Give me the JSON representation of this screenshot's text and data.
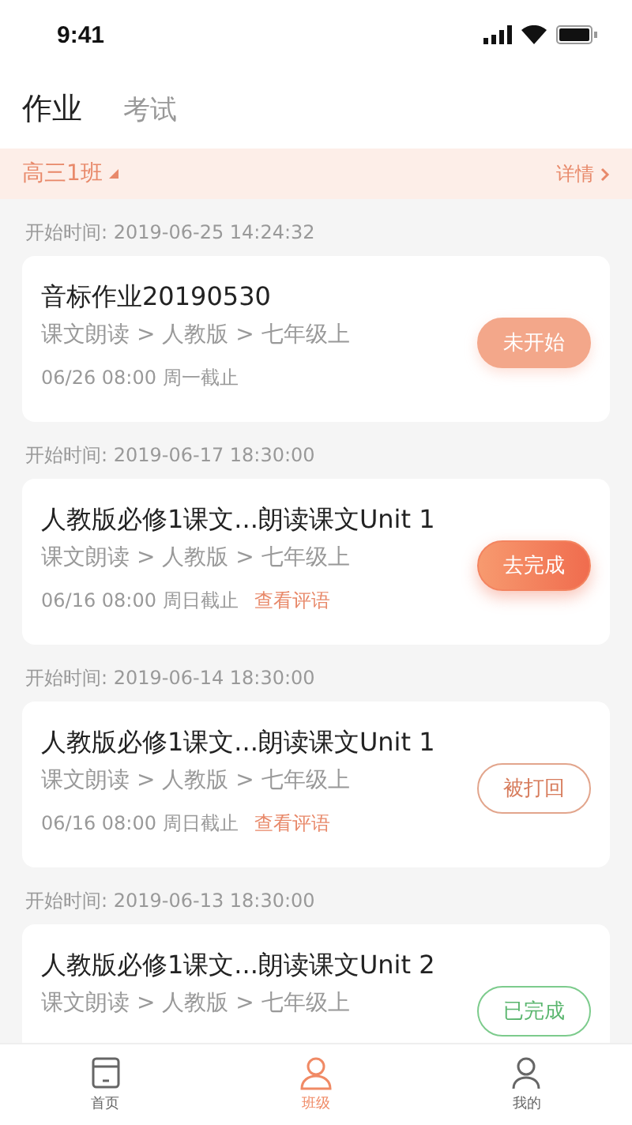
{
  "status_bar": {
    "time": "9:41"
  },
  "tabs": [
    {
      "label": "作业",
      "selected": true
    },
    {
      "label": "考试",
      "selected": false
    }
  ],
  "class_bar": {
    "class_name": "高三1班",
    "details": "详情"
  },
  "assignments": [
    {
      "start_label": "开始时间: 2019-06-25 14:24:32",
      "title": "音标作业20190530",
      "path": "课文朗读 > 人教版 > 七年级上",
      "deadline": "06/26 08:00 周一截止",
      "kind": "not_started",
      "action": "未开始"
    },
    {
      "start_label": "开始时间: 2019-06-17 18:30:00",
      "title": "人教版必修1课文...朗读课文Unit 1",
      "path": "课文朗读 > 人教版 > 七年级上",
      "deadline": "06/16 08:00 周日截止",
      "comment_link": "查看评语",
      "kind": "todo",
      "action": "去完成"
    },
    {
      "start_label": "开始时间: 2019-06-14 18:30:00",
      "title": "人教版必修1课文...朗读课文Unit 1",
      "path": "课文朗读 > 人教版 > 七年级上",
      "deadline": "06/16 08:00 周日截止",
      "comment_link": "查看评语",
      "kind": "rejected",
      "action": "被打回"
    },
    {
      "start_label": "开始时间: 2019-06-13 18:30:00",
      "title": "人教版必修1课文...朗读课文Unit 2",
      "path": "课文朗读 > 人教版 > 七年级上",
      "kind": "done",
      "action": "已完成"
    }
  ],
  "bottom_nav": [
    {
      "label": "首页",
      "kind": "home",
      "selected": false
    },
    {
      "label": "班级",
      "kind": "class",
      "selected": true
    },
    {
      "label": "我的",
      "kind": "me",
      "selected": false
    }
  ]
}
